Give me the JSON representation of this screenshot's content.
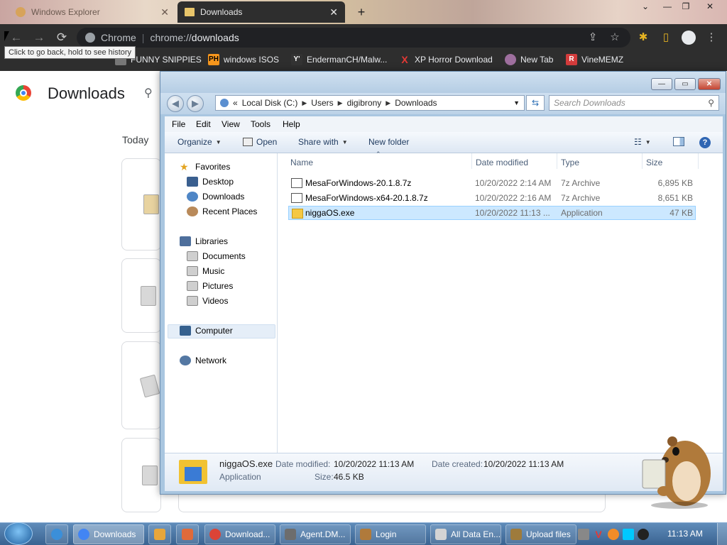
{
  "chrome": {
    "tabs": [
      {
        "title": "Windows Explorer",
        "active": false
      },
      {
        "title": "Downloads",
        "active": true
      }
    ],
    "new_tab_label": "+",
    "window_controls": {
      "chevron": "⌄",
      "minimize": "—",
      "maximize": "❐",
      "close": "✕"
    },
    "nav": {
      "back": "←",
      "forward": "→",
      "reload": "⟳"
    },
    "omnibox": {
      "scheme_label": "Chrome",
      "url_prefix": "chrome://",
      "url_host": "downloads"
    },
    "tooltip": "Click to go back, hold to see history",
    "toolbar_icons": [
      "share-icon",
      "star-icon",
      "extensions-icon",
      "sidepanel-icon",
      "profile-icon",
      "menu-icon"
    ],
    "bookmarks": [
      {
        "label": "FUNNY SNIPPIES",
        "icon_text": "",
        "icon_color": "#888888"
      },
      {
        "label": "windows ISOS",
        "icon_text": "PH",
        "icon_color": "#f7971d"
      },
      {
        "label": "EndermanCH/Malw...",
        "icon_text": "Y'",
        "icon_color": "#333333"
      },
      {
        "label": "XP Horror Download",
        "icon_text": "X",
        "icon_color": "#e53935"
      },
      {
        "label": "New Tab",
        "icon_text": "",
        "icon_color": "#9e6f9e"
      },
      {
        "label": "VineMEMZ",
        "icon_text": "R",
        "icon_color": "#d43c3c"
      }
    ],
    "page": {
      "title": "Downloads",
      "today_label": "Today"
    }
  },
  "explorer": {
    "caption": {
      "minimize": "—",
      "maximize": "▭",
      "close": "✕"
    },
    "address": {
      "prefix": "«",
      "crumbs": [
        "Local Disk (C:)",
        "Users",
        "digibrony",
        "Downloads"
      ]
    },
    "search_placeholder": "Search Downloads",
    "menu": [
      "File",
      "Edit",
      "View",
      "Tools",
      "Help"
    ],
    "commands": {
      "organize": "Organize",
      "open": "Open",
      "share_with": "Share with",
      "new_folder": "New folder"
    },
    "nav": {
      "favorites": {
        "label": "Favorites",
        "items": [
          "Desktop",
          "Downloads",
          "Recent Places"
        ]
      },
      "libraries": {
        "label": "Libraries",
        "items": [
          "Documents",
          "Music",
          "Pictures",
          "Videos"
        ]
      },
      "computer": "Computer",
      "network": "Network"
    },
    "columns": [
      "Name",
      "Date modified",
      "Type",
      "Size"
    ],
    "files": [
      {
        "name": "MesaForWindows-20.1.8.7z",
        "date": "10/20/2022 2:14 AM",
        "type": "7z Archive",
        "size": "6,895 KB",
        "selected": false,
        "kind": "archive"
      },
      {
        "name": "MesaForWindows-x64-20.1.8.7z",
        "date": "10/20/2022 2:16 AM",
        "type": "7z Archive",
        "size": "8,651 KB",
        "selected": false,
        "kind": "archive"
      },
      {
        "name": "niggaOS.exe",
        "date": "10/20/2022 11:13 ...",
        "type": "Application",
        "size": "47 KB",
        "selected": true,
        "kind": "exe"
      }
    ],
    "details": {
      "name": "niggaOS.exe",
      "kind": "Application",
      "modified_label": "Date modified:",
      "modified": "10/20/2022 11:13 AM",
      "created_label": "Date created:",
      "created": "10/20/2022 11:13 AM",
      "size_label": "Size:",
      "size": "46.5 KB"
    }
  },
  "taskbar": {
    "buttons": [
      {
        "label": "Downloads",
        "active": true,
        "icon_color": "#4285f4"
      },
      {
        "label": "Download...",
        "active": false,
        "icon_color": "#db4437"
      },
      {
        "label": "Agent.DM...",
        "active": false,
        "icon_color": "#6d6d6d"
      },
      {
        "label": "Login",
        "active": false,
        "icon_color": "#b07a3b"
      },
      {
        "label": "All Data En...",
        "active": false,
        "icon_color": "#d4d4d4"
      },
      {
        "label": "Upload files",
        "active": false,
        "icon_color": "#9e7b3c"
      }
    ],
    "clock": "11:13 AM"
  }
}
